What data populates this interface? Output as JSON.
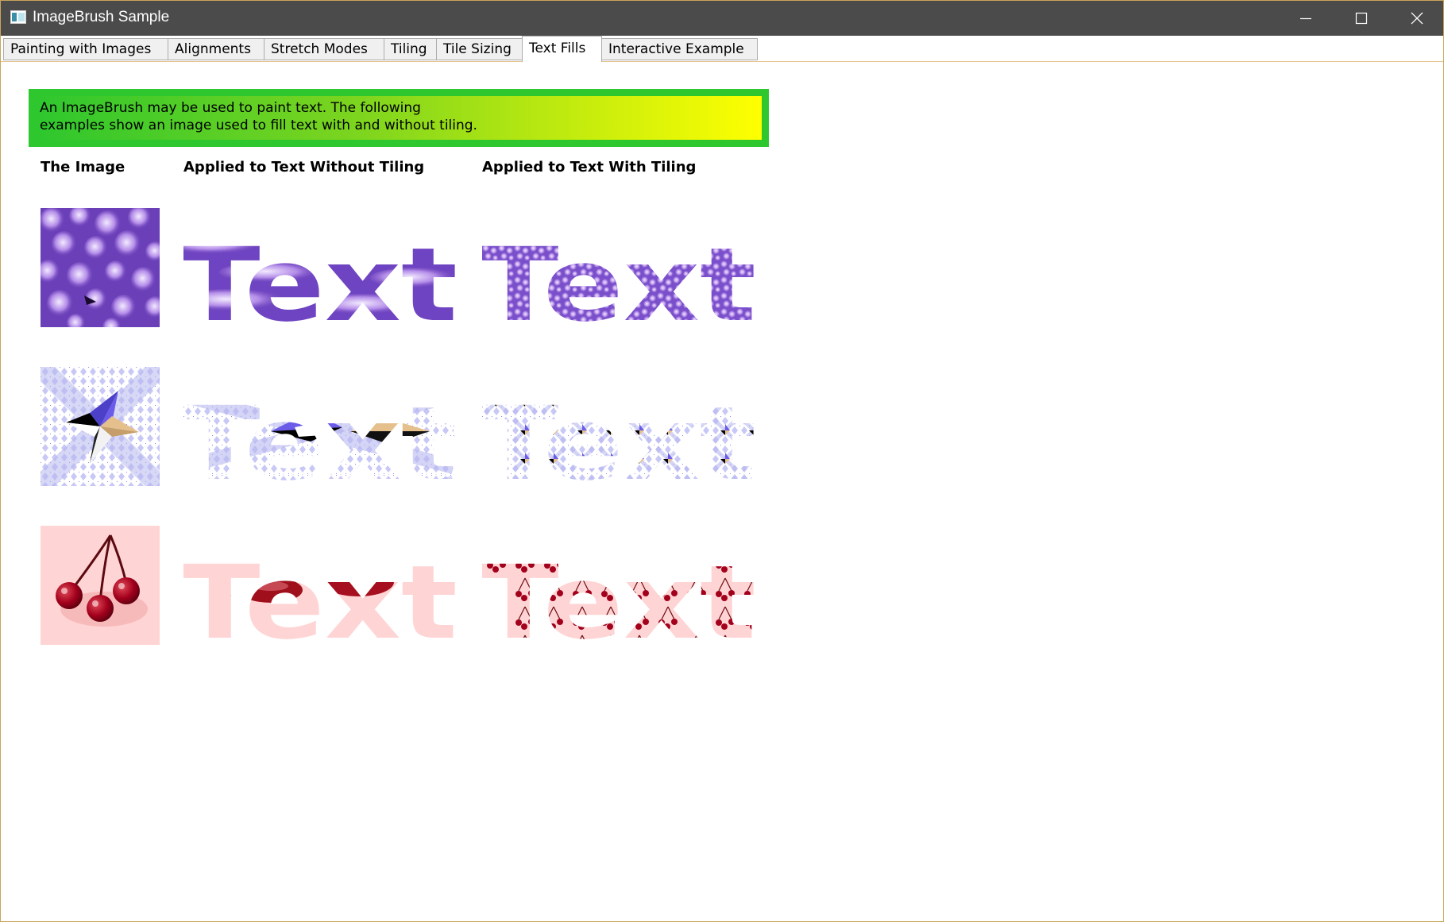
{
  "window": {
    "title": "ImageBrush Sample"
  },
  "tabs": [
    {
      "label": "Painting with Images"
    },
    {
      "label": "Alignments"
    },
    {
      "label": "Stretch Modes"
    },
    {
      "label": "Tiling"
    },
    {
      "label": "Tile Sizing"
    },
    {
      "label": "Text Fills",
      "active": true
    },
    {
      "label": "Interactive Example"
    }
  ],
  "content": {
    "description": "An ImageBrush may be used to paint text. The following examples show an image used to fill text with and without tiling.",
    "headers": {
      "image": "The Image",
      "without_tiling": "Applied to Text Without Tiling",
      "with_tiling": "Applied to Text With Tiling"
    },
    "sample_word": "Text",
    "rows": [
      {
        "image": "purple-bubbles-image"
      },
      {
        "image": "star-pattern-image"
      },
      {
        "image": "cherries-image"
      }
    ]
  },
  "colors": {
    "titlebar": "#4b4b4b",
    "banner_border": "#2ec72e",
    "gradient_end": "#ffff00",
    "purple": "#8a5cd6",
    "star_blue": "#6666ee",
    "cherry_red": "#a3001c",
    "cherry_bg": "#ffd0d0"
  }
}
